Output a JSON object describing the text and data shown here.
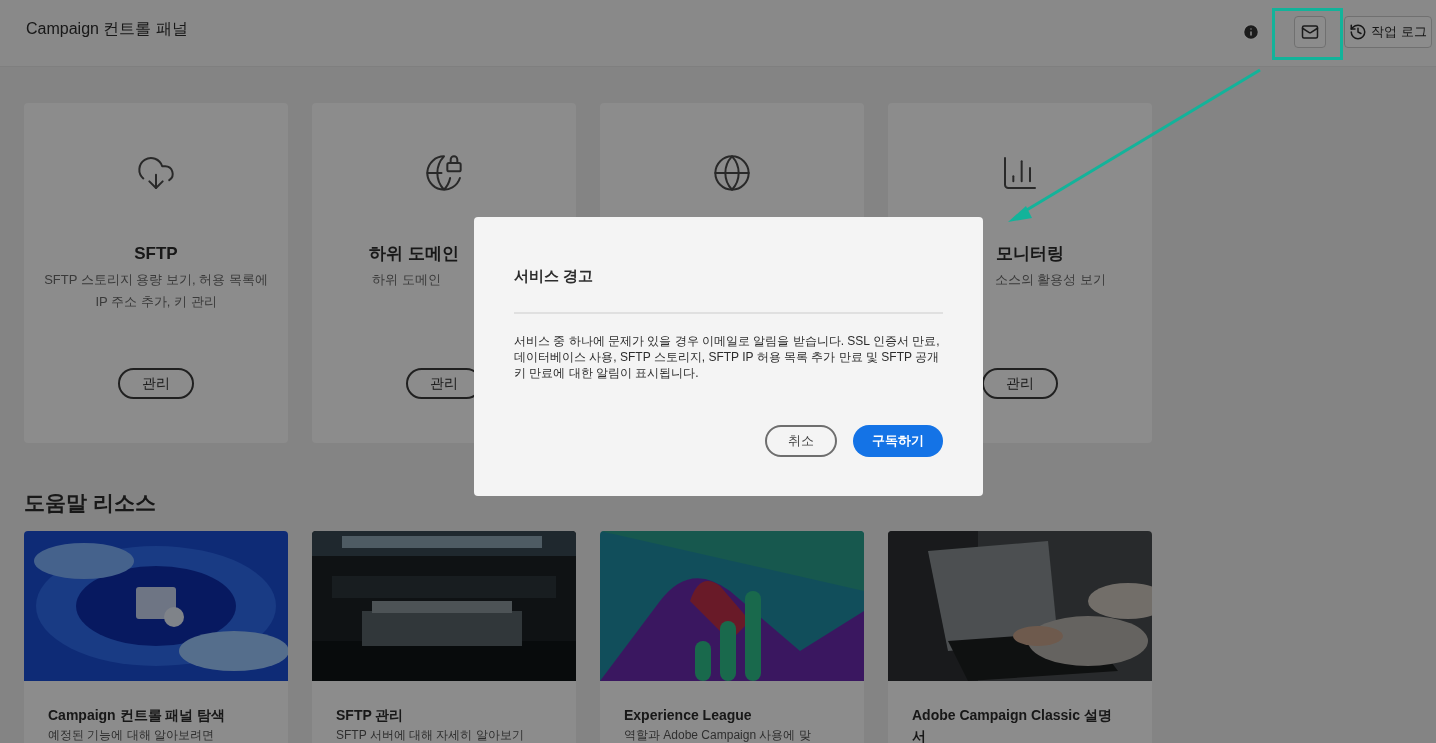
{
  "header": {
    "title": "Campaign 컨트롤 패널",
    "log_button": "작업 로그"
  },
  "cards": [
    {
      "kind": "cloud",
      "title": "SFTP",
      "description": "SFTP 스토리지 용량 보기, 허용 목록에 IP 주소 추가, 키 관리",
      "button": "관리"
    },
    {
      "kind": "shield",
      "title": "하위 도메인",
      "description": "하위 도메인",
      "button": "관리"
    },
    {
      "kind": "link"
    },
    {
      "kind": "chart",
      "title": "모니터링",
      "description": "소스의 활용성 보기",
      "button": "관리"
    }
  ],
  "help": {
    "title": "도움말 리소스",
    "items": [
      {
        "kind": "swirl",
        "title": "Campaign 컨트롤 패널 탐색",
        "description": "예정된 기능에 대해 알아보려면"
      },
      {
        "kind": "room",
        "title": "SFTP 관리",
        "description": "SFTP 서버에 대해 자세히 알아보기"
      },
      {
        "kind": "ribbon",
        "title": "Experience League",
        "description": "역할과 Adobe Campaign 사용에 맞"
      },
      {
        "kind": "laptop",
        "title": "Adobe Campaign Classic 설명서"
      }
    ]
  },
  "dialog": {
    "title": "서비스 경고",
    "body": "서비스 중 하나에 문제가 있을 경우 이메일로 알림을 받습니다. SSL 인증서 만료, 데이터베이스 사용, SFTP 스토리지, SFTP IP 허용 목록 추가 만료 및 SFTP 공개 키 만료에 대한 알림이 표시됩니다.",
    "cancel": "취소",
    "confirm": "구독하기"
  }
}
